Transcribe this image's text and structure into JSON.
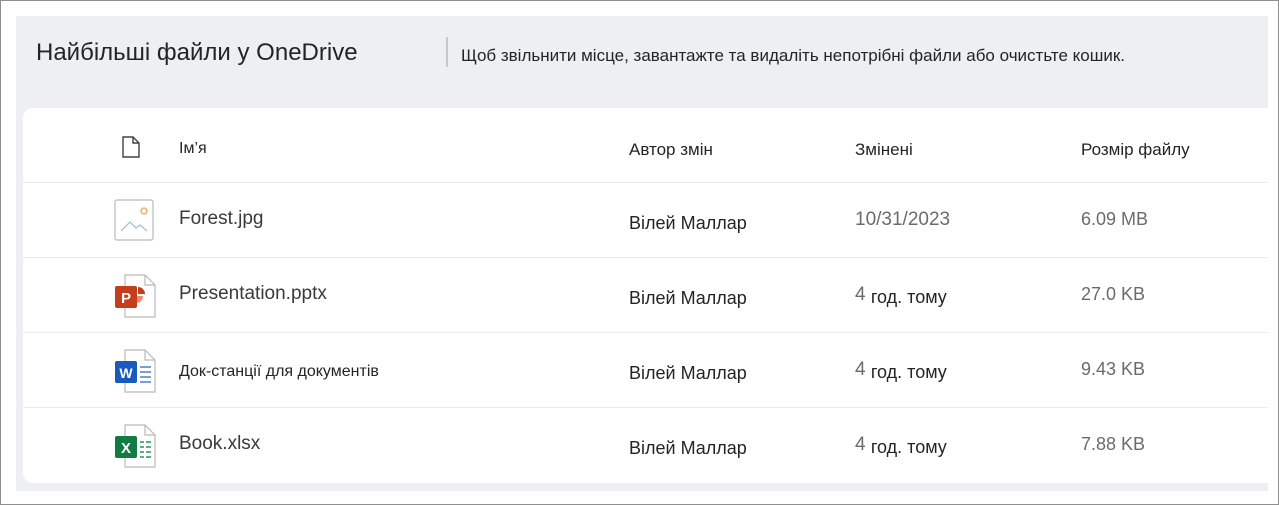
{
  "header": {
    "title": "Найбільші файли у OneDrive",
    "subtitle": "Щоб звільнити місце, завантажте та видаліть непотрібні файли або очистьте кошик."
  },
  "columns": {
    "name": "Ім’я",
    "author": "Автор змін",
    "modified": "Змінені",
    "size": "Розмір файлу"
  },
  "files": [
    {
      "name": "Forest.jpg",
      "icon": "image-file-icon",
      "author": "Вілей Маллар",
      "modified_num": "10/31/2023",
      "modified_unit": "",
      "size": "6.09 MB"
    },
    {
      "name": "Presentation.pptx",
      "icon": "powerpoint-file-icon",
      "author": "Вілей Маллар",
      "modified_num": "4",
      "modified_unit": "год. тому",
      "size": "27.0 KB"
    },
    {
      "name": "Док-станції для документів",
      "icon": "word-file-icon",
      "author": "Вілей Маллар",
      "modified_num": "4",
      "modified_unit": "год. тому",
      "size": "9.43 KB"
    },
    {
      "name": "Book.xlsx",
      "icon": "excel-file-icon",
      "author": "Вілей Маллар",
      "modified_num": "4",
      "modified_unit": "год. тому",
      "size": "7.88 KB"
    }
  ],
  "colors": {
    "powerpoint": "#c43e1c",
    "word": "#185abd",
    "excel": "#107c41",
    "background": "#eeeff3"
  }
}
